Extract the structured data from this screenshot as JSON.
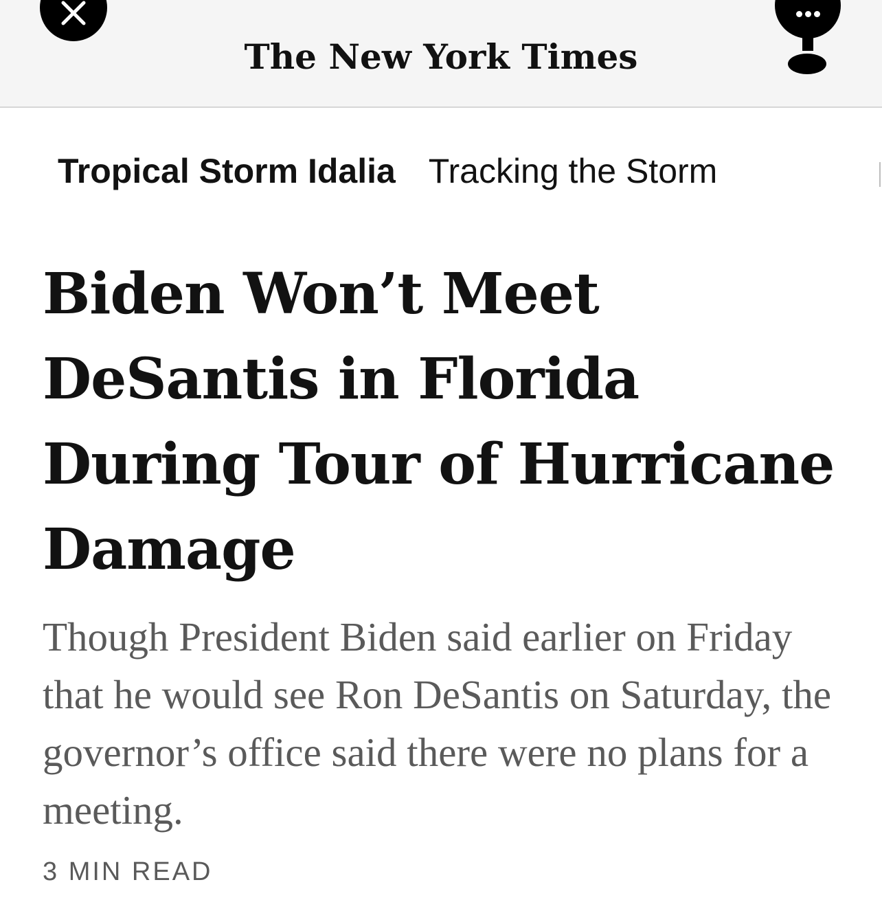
{
  "header": {
    "masthead": "The New York Times",
    "close_icon": "close-icon",
    "menu_icon": "more-icon"
  },
  "tags": {
    "primary": "Tropical Storm Idalia",
    "secondary": "Tracking the Storm"
  },
  "article": {
    "headline": "Biden Won’t Meet DeSantis in Florida During Tour of Hurricane Damage",
    "summary": "Though President Biden said earlier on Friday that he would see Ron DeSantis on Saturday, the governor’s office said there were no plans for a meeting.",
    "read_time": "3 MIN READ"
  },
  "colors": {
    "text": "#121212",
    "summary_text": "#5a5a5a",
    "topbar_bg": "#f5f5f5"
  }
}
